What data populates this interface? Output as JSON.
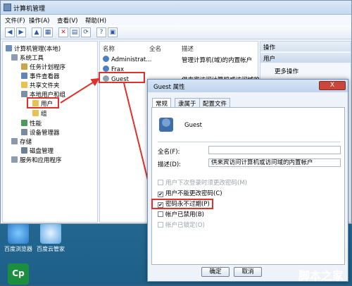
{
  "window": {
    "title": "计算机管理"
  },
  "menu": [
    "文件(F)",
    "操作(A)",
    "查看(V)",
    "帮助(H)"
  ],
  "tree": {
    "root": "计算机管理(本地)",
    "system_tools": "系统工具",
    "task_scheduler": "任务计划程序",
    "event_viewer": "事件查看器",
    "shared_folders": "共享文件夹",
    "local_users_groups": "本地用户和组",
    "users": "用户",
    "groups": "组",
    "performance": "性能",
    "device_manager": "设备管理器",
    "storage": "存储",
    "disk_management": "磁盘管理",
    "services_apps": "服务和应用程序"
  },
  "list": {
    "headers": [
      "名称",
      "全名",
      "描述"
    ],
    "rows": [
      {
        "name": "Administrat...",
        "full": "",
        "desc": "管理计算机(域)的内置帐户"
      },
      {
        "name": "Frax",
        "full": "",
        "desc": ""
      },
      {
        "name": "Guest",
        "full": "",
        "desc": "供来宾访问计算机或访问域的内..."
      }
    ]
  },
  "actions": {
    "header": "操作",
    "sub": "用户",
    "more": "更多操作"
  },
  "dialog": {
    "title": "Guest 属性",
    "tabs": [
      "常规",
      "隶属于",
      "配置文件"
    ],
    "username": "Guest",
    "fullname_label": "全名(F):",
    "fullname_value": "",
    "desc_label": "描述(D):",
    "desc_value": "供来宾访问计算机或访问域的内置帐户",
    "cb1": "用户下次登录时须更改密码(M)",
    "cb2": "用户不能更改密码(C)",
    "cb3": "密码永不过期(P)",
    "cb4": "帐户已禁用(B)",
    "cb5": "帐户已锁定(O)",
    "ok": "确定",
    "cancel": "取消",
    "close": "X"
  },
  "desktop": {
    "icon1": "百度浏览器",
    "icon2": "百度云管家",
    "icon3": "Cp"
  },
  "watermark": {
    "site": "jb51.net",
    "brand": "脚本之家"
  }
}
